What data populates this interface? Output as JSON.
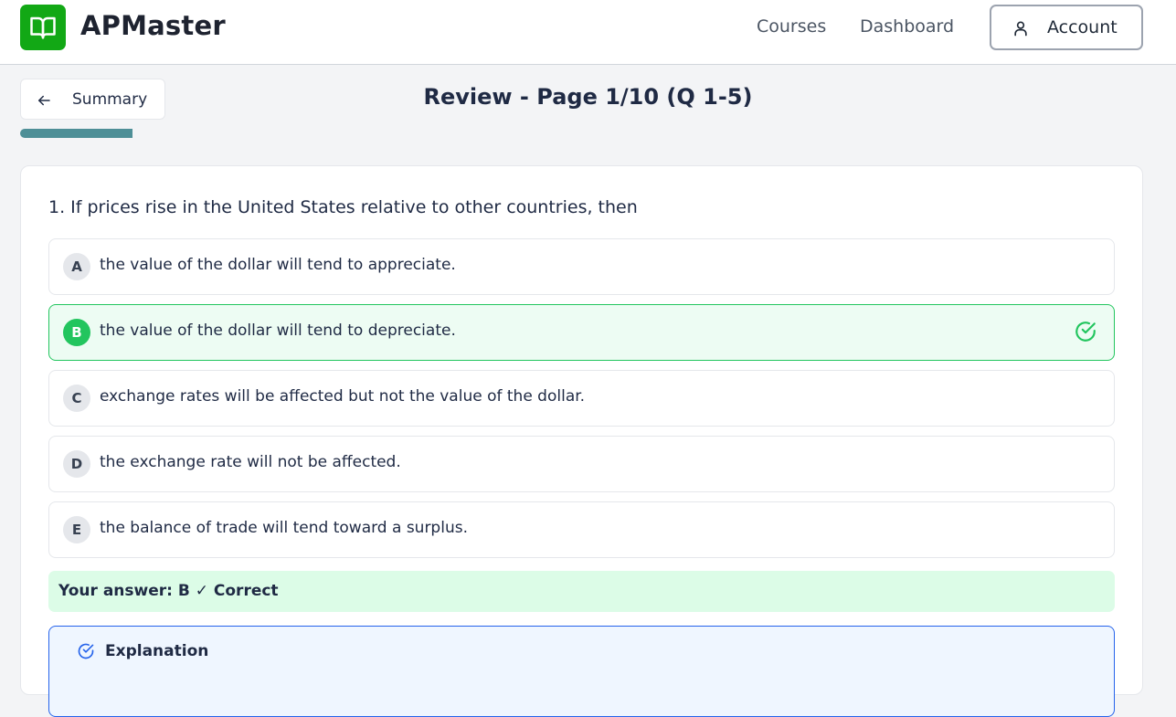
{
  "header": {
    "brand": "APMaster",
    "nav": [
      "Courses",
      "Dashboard"
    ],
    "account_label": "Account",
    "logo_icon": "book-icon",
    "brand_color": "#12a815"
  },
  "subheader": {
    "back_label": "Summary",
    "page_title": "Review - Page 1/10 (Q 1-5)",
    "progress_fraction": 0.1,
    "progress_color": "#4e8f97"
  },
  "question": {
    "text": "1. If prices rise in the United States relative to other countries, then",
    "options": [
      {
        "letter": "A",
        "text": "the value of the dollar will tend to appreciate."
      },
      {
        "letter": "B",
        "text": "the value of the dollar will tend to depreciate."
      },
      {
        "letter": "C",
        "text": "exchange rates will be affected but not the value of the dollar."
      },
      {
        "letter": "D",
        "text": "the exchange rate will not be affected."
      },
      {
        "letter": "E",
        "text": "the balance of trade will tend toward a surplus."
      }
    ],
    "selected": "B",
    "answer_text": "Your answer: B ✓ Correct",
    "explanation_label": "Explanation",
    "correct_color": "#22c55e"
  }
}
